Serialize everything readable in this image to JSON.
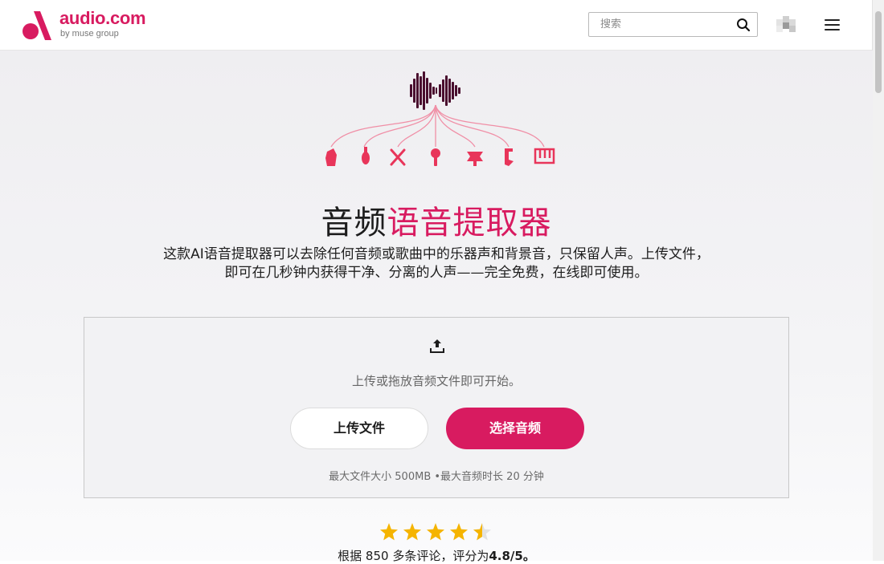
{
  "brand": {
    "name": "audio.com",
    "tagline": "by muse group",
    "accent_color": "#d81b60"
  },
  "header": {
    "search_placeholder": "搜索",
    "search_icon": "search-icon",
    "menu_icon": "hamburger-menu-icon"
  },
  "hero": {
    "title_plain": "音频",
    "title_accent": "语音提取器",
    "description": "这款AI语音提取器可以去除任何音频或歌曲中的乐器声和背景音，只保留人声。上传文件，即可在几秒钟内获得干净、分离的人声——完全免费，在线即可使用。",
    "instrument_icons": [
      "electric-guitar-icon",
      "violin-icon",
      "drumsticks-icon",
      "microphone-icon",
      "trumpet-icon",
      "saxophone-icon",
      "keyboard-icon"
    ]
  },
  "upload": {
    "icon": "upload-icon",
    "hint": "上传或拖放音频文件即可开始。",
    "upload_button": "上传文件",
    "choose_button": "选择音频",
    "limits": "最大文件大小 500MB •最大音频时长 20 分钟"
  },
  "rating": {
    "score": 4.8,
    "max": 5,
    "text_prefix": "根据 850 多条评论，评分为",
    "text_value": "4.8/5。",
    "star_color": "#f5b400"
  }
}
